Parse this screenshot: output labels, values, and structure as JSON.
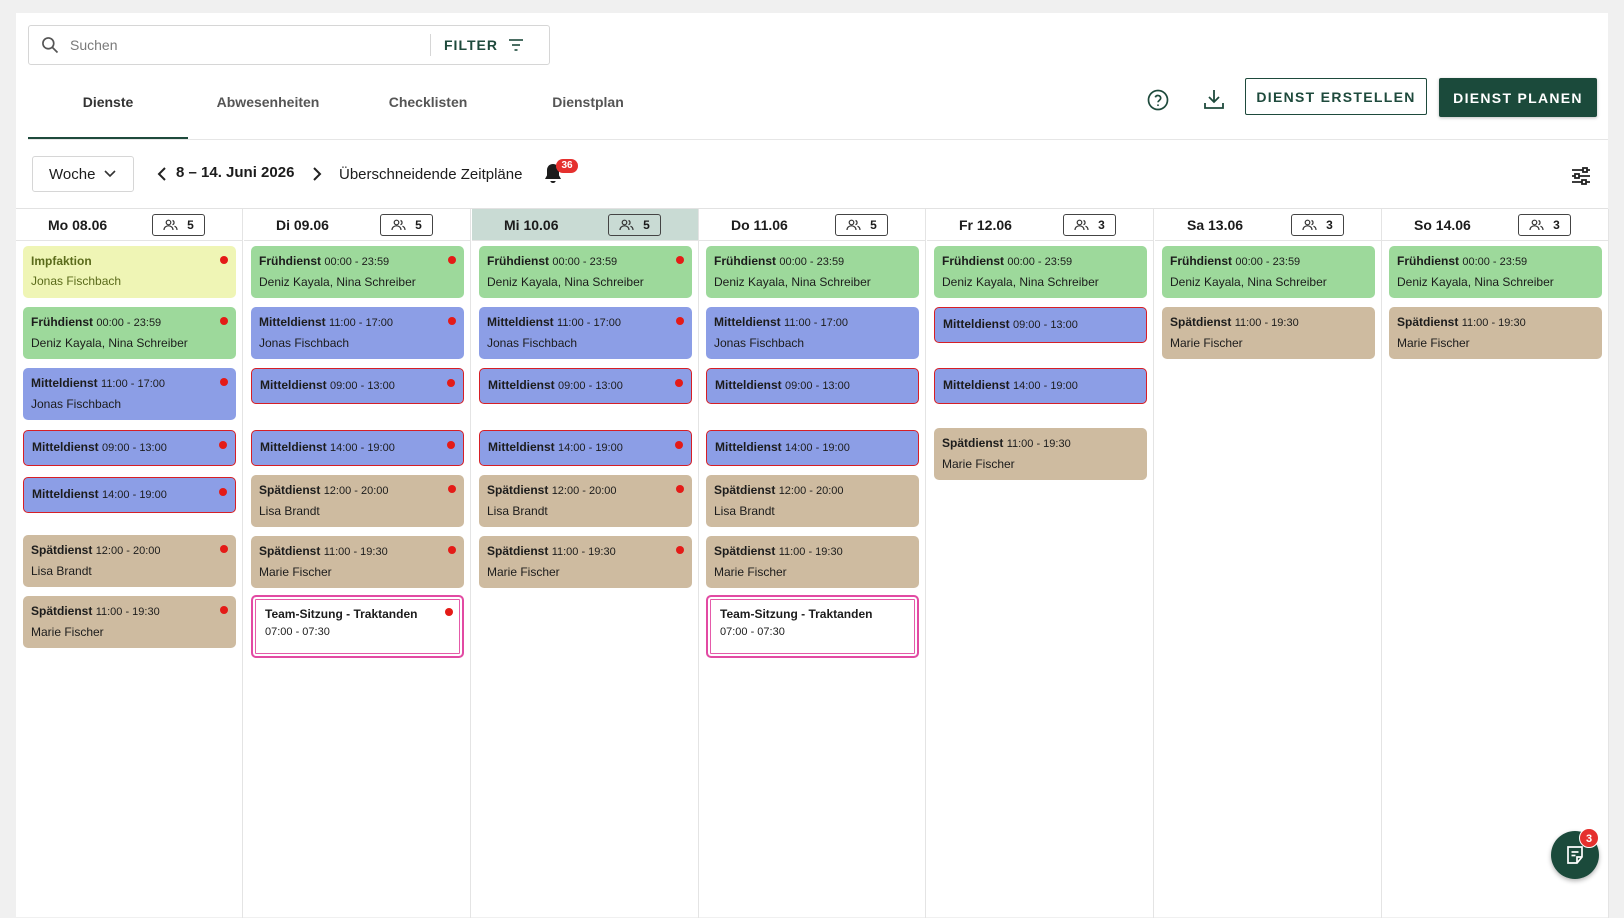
{
  "search": {
    "placeholder": "Suchen",
    "filter_label": "FILTER"
  },
  "tabs": [
    {
      "label": "Dienste",
      "active": true
    },
    {
      "label": "Abwesenheiten",
      "active": false
    },
    {
      "label": "Checklisten",
      "active": false
    },
    {
      "label": "Dienstplan",
      "active": false
    }
  ],
  "toolbar": {
    "help_icon": "help-circle-icon",
    "download_icon": "download-icon",
    "create_label": "DIENST ERSTELLEN",
    "plan_label": "DIENST PLANEN"
  },
  "week": {
    "view_select": "Woche",
    "range": "8 – 14. Juni 2026",
    "overlap_label": "Überschneidende Zeitpläne",
    "notification_count": "36"
  },
  "colors": {
    "brand": "#1b4a3b",
    "frueh": "#9dd99b",
    "mittel": "#8c9ee6",
    "spaet": "#cebba0",
    "impf": "#eff5b5",
    "today": "#c9dbd4",
    "alert": "#e41b17"
  },
  "days": [
    {
      "label": "Mo 08.06",
      "staff": "5",
      "today": false,
      "shifts": [
        {
          "type": "impf",
          "title": "Impfaktion",
          "time": "",
          "people": "Jonas Fischbach",
          "dot": true,
          "outlined": false
        },
        {
          "type": "frueh",
          "title": "Frühdienst",
          "time": "00:00 - 23:59",
          "people": "Deniz Kayala, Nina Schreiber",
          "dot": true,
          "outlined": false
        },
        {
          "type": "mittel",
          "title": "Mitteldienst",
          "time": "11:00 - 17:00",
          "people": "Jonas Fischbach",
          "dot": true,
          "outlined": false
        },
        {
          "type": "mittel",
          "title": "Mitteldienst",
          "time": "09:00 - 13:00",
          "people": "",
          "dot": true,
          "outlined": true
        },
        {
          "type": "mittel",
          "title": "Mitteldienst",
          "time": "14:00 - 19:00",
          "people": "",
          "dot": true,
          "outlined": true
        },
        {
          "type": "spaet",
          "title": "Spätdienst",
          "time": "12:00 - 20:00",
          "people": "Lisa Brandt",
          "dot": true,
          "outlined": false
        },
        {
          "type": "spaet",
          "title": "Spätdienst",
          "time": "11:00 - 19:30",
          "people": "Marie Fischer",
          "dot": true,
          "outlined": false
        }
      ]
    },
    {
      "label": "Di 09.06",
      "staff": "5",
      "today": false,
      "shifts": [
        {
          "type": "frueh",
          "title": "Frühdienst",
          "time": "00:00 - 23:59",
          "people": "Deniz Kayala, Nina Schreiber",
          "dot": true,
          "outlined": false
        },
        {
          "type": "mittel",
          "title": "Mitteldienst",
          "time": "11:00 - 17:00",
          "people": "Jonas Fischbach",
          "dot": true,
          "outlined": false
        },
        {
          "type": "mittel",
          "title": "Mitteldienst",
          "time": "09:00 - 13:00",
          "people": "",
          "dot": true,
          "outlined": true
        },
        {
          "type": "mittel",
          "title": "Mitteldienst",
          "time": "14:00 - 19:00",
          "people": "",
          "dot": true,
          "outlined": true
        },
        {
          "type": "spaet",
          "title": "Spätdienst",
          "time": "12:00 - 20:00",
          "people": "Lisa Brandt",
          "dot": true,
          "outlined": false
        },
        {
          "type": "spaet",
          "title": "Spätdienst",
          "time": "11:00 - 19:30",
          "people": "Marie Fischer",
          "dot": true,
          "outlined": false
        },
        {
          "type": "meeting",
          "title": "Team-Sitzung - Traktanden",
          "time": "",
          "people": "07:00 - 07:30",
          "dot": true,
          "outlined": false
        }
      ]
    },
    {
      "label": "Mi 10.06",
      "staff": "5",
      "today": true,
      "shifts": [
        {
          "type": "frueh",
          "title": "Frühdienst",
          "time": "00:00 - 23:59",
          "people": "Deniz Kayala, Nina Schreiber",
          "dot": true,
          "outlined": false
        },
        {
          "type": "mittel",
          "title": "Mitteldienst",
          "time": "11:00 - 17:00",
          "people": "Jonas Fischbach",
          "dot": true,
          "outlined": false
        },
        {
          "type": "mittel",
          "title": "Mitteldienst",
          "time": "09:00 - 13:00",
          "people": "",
          "dot": true,
          "outlined": true
        },
        {
          "type": "mittel",
          "title": "Mitteldienst",
          "time": "14:00 - 19:00",
          "people": "",
          "dot": true,
          "outlined": true
        },
        {
          "type": "spaet",
          "title": "Spätdienst",
          "time": "12:00 - 20:00",
          "people": "Lisa Brandt",
          "dot": true,
          "outlined": false
        },
        {
          "type": "spaet",
          "title": "Spätdienst",
          "time": "11:00 - 19:30",
          "people": "Marie Fischer",
          "dot": true,
          "outlined": false
        }
      ]
    },
    {
      "label": "Do 11.06",
      "staff": "5",
      "today": false,
      "shifts": [
        {
          "type": "frueh",
          "title": "Frühdienst",
          "time": "00:00 - 23:59",
          "people": "Deniz Kayala, Nina Schreiber",
          "dot": false,
          "outlined": false
        },
        {
          "type": "mittel",
          "title": "Mitteldienst",
          "time": "11:00 - 17:00",
          "people": "Jonas Fischbach",
          "dot": false,
          "outlined": false
        },
        {
          "type": "mittel",
          "title": "Mitteldienst",
          "time": "09:00 - 13:00",
          "people": "",
          "dot": false,
          "outlined": true
        },
        {
          "type": "mittel",
          "title": "Mitteldienst",
          "time": "14:00 - 19:00",
          "people": "",
          "dot": false,
          "outlined": true
        },
        {
          "type": "spaet",
          "title": "Spätdienst",
          "time": "12:00 - 20:00",
          "people": "Lisa Brandt",
          "dot": false,
          "outlined": false
        },
        {
          "type": "spaet",
          "title": "Spätdienst",
          "time": "11:00 - 19:30",
          "people": "Marie Fischer",
          "dot": false,
          "outlined": false
        },
        {
          "type": "meeting",
          "title": "Team-Sitzung - Traktanden",
          "time": "",
          "people": "07:00 - 07:30",
          "dot": false,
          "outlined": false
        }
      ]
    },
    {
      "label": "Fr 12.06",
      "staff": "3",
      "today": false,
      "shifts": [
        {
          "type": "frueh",
          "title": "Frühdienst",
          "time": "00:00 - 23:59",
          "people": "Deniz Kayala, Nina Schreiber",
          "dot": false,
          "outlined": false
        },
        {
          "type": "mittel",
          "title": "Mitteldienst",
          "time": "09:00 - 13:00",
          "people": "",
          "dot": false,
          "outlined": true
        },
        {
          "type": "mittel",
          "title": "Mitteldienst",
          "time": "14:00 - 19:00",
          "people": "",
          "dot": false,
          "outlined": true
        },
        {
          "type": "spaet",
          "title": "Spätdienst",
          "time": "11:00 - 19:30",
          "people": "Marie Fischer",
          "dot": false,
          "outlined": false
        }
      ]
    },
    {
      "label": "Sa 13.06",
      "staff": "3",
      "today": false,
      "shifts": [
        {
          "type": "frueh",
          "title": "Frühdienst",
          "time": "00:00 - 23:59",
          "people": "Deniz Kayala, Nina Schreiber",
          "dot": false,
          "outlined": false
        },
        {
          "type": "spaet",
          "title": "Spätdienst",
          "time": "11:00 - 19:30",
          "people": "Marie Fischer",
          "dot": false,
          "outlined": false
        }
      ]
    },
    {
      "label": "So 14.06",
      "staff": "3",
      "today": false,
      "shifts": [
        {
          "type": "frueh",
          "title": "Frühdienst",
          "time": "00:00 - 23:59",
          "people": "Deniz Kayala, Nina Schreiber",
          "dot": false,
          "outlined": false
        },
        {
          "type": "spaet",
          "title": "Spätdienst",
          "time": "11:00 - 19:30",
          "people": "Marie Fischer",
          "dot": false,
          "outlined": false
        }
      ]
    }
  ],
  "fab": {
    "icon": "notes-icon",
    "badge": "3"
  }
}
